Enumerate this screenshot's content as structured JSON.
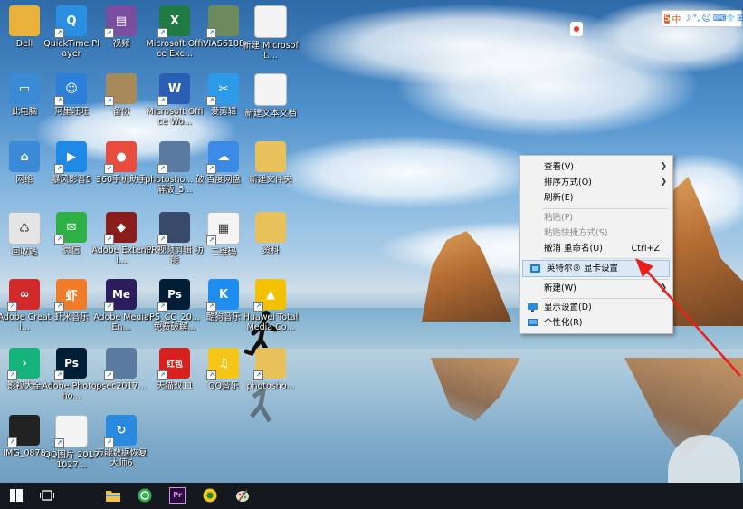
{
  "desktop_icons": [
    {
      "label": "Dell",
      "color": "#e8b13a",
      "glyph": "",
      "icon": "folder-person-icon"
    },
    {
      "label": "QuickTime Player",
      "color": "#2a8fe0",
      "glyph": "Q",
      "icon": "quicktime-icon"
    },
    {
      "label": "视频",
      "color": "#7a4e9e",
      "glyph": "▤",
      "icon": "video-library-icon"
    },
    {
      "label": "Microsoft Office Exc...",
      "color": "#1f7a43",
      "glyph": "X",
      "icon": "excel-icon"
    },
    {
      "label": "VIAS6108",
      "color": "#6c8a5b",
      "glyph": "",
      "icon": "image-file-icon"
    },
    {
      "label": "新建 Microsoft....",
      "color": "#f4f4f4",
      "glyph": "",
      "icon": "document-icon"
    },
    {
      "label": "此电脑",
      "color": "#3a8ad6",
      "glyph": "▭",
      "icon": "computer-icon"
    },
    {
      "label": "阿里旺旺",
      "color": "#2e7fd8",
      "glyph": "☺",
      "icon": "aliwangwang-icon"
    },
    {
      "label": "备份",
      "color": "#a88a5a",
      "glyph": "",
      "icon": "backup-folder-icon"
    },
    {
      "label": "Microsoft Office Wo...",
      "color": "#2b5fb4",
      "glyph": "W",
      "icon": "word-icon"
    },
    {
      "label": "爱剪辑",
      "color": "#2d9be8",
      "glyph": "✂",
      "icon": "aijianji-icon"
    },
    {
      "label": "新建文本文档",
      "color": "#f4f4f4",
      "glyph": "",
      "icon": "text-document-icon"
    },
    {
      "label": "网络",
      "color": "#3a8ad6",
      "glyph": "⌂",
      "icon": "network-icon"
    },
    {
      "label": "暴风影音5",
      "color": "#1e88e5",
      "glyph": "▶",
      "icon": "baofeng-icon"
    },
    {
      "label": "360手机助手",
      "color": "#e94b3c",
      "glyph": "●",
      "icon": "phone-assistant-icon"
    },
    {
      "label": "photosho... 破解版_5...",
      "color": "#5a7aa0",
      "glyph": "",
      "icon": "installer-icon"
    },
    {
      "label": "百度网盘",
      "color": "#3a8ae6",
      "glyph": "☁",
      "icon": "baidu-netdisk-icon"
    },
    {
      "label": "新建文件夹",
      "color": "#e8c15a",
      "glyph": "",
      "icon": "folder-icon"
    },
    {
      "label": "回收站",
      "color": "#e5e5e5",
      "glyph": "♺",
      "icon": "recycle-bin-icon"
    },
    {
      "label": "微信",
      "color": "#2fb046",
      "glyph": "✉",
      "icon": "wechat-icon"
    },
    {
      "label": "Adobe Extensi...",
      "color": "#8a1c1c",
      "glyph": "◆",
      "icon": "adobe-extension-icon"
    },
    {
      "label": "PR视频剪辑 功能",
      "color": "#3a4a6a",
      "glyph": "",
      "icon": "video-thumbnail-icon"
    },
    {
      "label": "二维码",
      "color": "#f4f4f4",
      "glyph": "▦",
      "icon": "qrcode-doc-icon"
    },
    {
      "label": "资料",
      "color": "#e8c15a",
      "glyph": "",
      "icon": "folder-icon"
    },
    {
      "label": "Adobe Creati...",
      "color": "#d22a2a",
      "glyph": "∞",
      "icon": "adobe-cc-icon"
    },
    {
      "label": "虾米音乐",
      "color": "#f07c2a",
      "glyph": "虾",
      "icon": "xiami-icon"
    },
    {
      "label": "Adobe Media En...",
      "color": "#2c1e5e",
      "glyph": "Me",
      "icon": "media-encoder-icon"
    },
    {
      "label": "PS_CC_20... 免费破解...",
      "color": "#001e36",
      "glyph": "Ps",
      "icon": "photoshop-icon"
    },
    {
      "label": "酷狗音乐",
      "color": "#1f8cf0",
      "glyph": "K",
      "icon": "kugou-icon"
    },
    {
      "label": "Huawei Total Media Co...",
      "color": "#f2c200",
      "glyph": "▲",
      "icon": "huawei-media-icon"
    },
    {
      "label": "影视大全",
      "color": "#17b37c",
      "glyph": "›",
      "icon": "video-app-icon"
    },
    {
      "label": "Adobe Photosho...",
      "color": "#001e36",
      "glyph": "Ps",
      "icon": "photoshop-icon"
    },
    {
      "label": "psec2017...",
      "color": "#5a7aa0",
      "glyph": "",
      "icon": "installer-icon"
    },
    {
      "label": "天猫双11",
      "color": "#d8201f",
      "glyph": "红包",
      "icon": "tmall-icon"
    },
    {
      "label": "QQ音乐",
      "color": "#f5c518",
      "glyph": "♫",
      "icon": "qqmusic-icon"
    },
    {
      "label": "photosho...",
      "color": "#e8c15a",
      "glyph": "",
      "icon": "folder-icon"
    },
    {
      "label": "IMG_0878",
      "color": "#222",
      "glyph": "",
      "icon": "photo-thumbnail-icon"
    },
    {
      "label": "QQ图片 20171027...",
      "color": "#f4f4f4",
      "glyph": "",
      "icon": "image-thumbnail-icon"
    },
    {
      "label": "万能数据恢复大师6",
      "color": "#2a8ae0",
      "glyph": "↻",
      "icon": "data-recovery-icon"
    }
  ],
  "context_menu": {
    "items": [
      {
        "label": "查看(V)",
        "submenu": true
      },
      {
        "label": "排序方式(O)",
        "submenu": true
      },
      {
        "label": "刷新(E)"
      },
      {
        "label": "粘贴(P)",
        "disabled": true
      },
      {
        "label": "粘贴快捷方式(S)",
        "disabled": true
      },
      {
        "label": "撤消 重命名(U)",
        "shortcut": "Ctrl+Z"
      },
      {
        "label": "英特尔® 显卡设置",
        "highlighted": true,
        "icon": "intel-graphics-icon"
      },
      {
        "label": "新建(W)",
        "submenu": true
      },
      {
        "label": "显示设置(D)",
        "icon": "display-icon"
      },
      {
        "label": "个性化(R)",
        "icon": "personalize-icon"
      }
    ]
  },
  "ime_toolbar": {
    "items": [
      "S",
      "中",
      "☽",
      "°,",
      "☺",
      "⌨",
      "👕",
      "⊞"
    ]
  },
  "taskbar": {
    "items": [
      "start-button",
      "task-view-button",
      "file-explorer-button",
      "360-browser-button",
      "premiere-button",
      "qq-music-button",
      "paint-button"
    ]
  },
  "colors": {
    "accent": "#cde4f8",
    "annotation_arrow": "#e8201c",
    "taskbar": "#14191f"
  }
}
